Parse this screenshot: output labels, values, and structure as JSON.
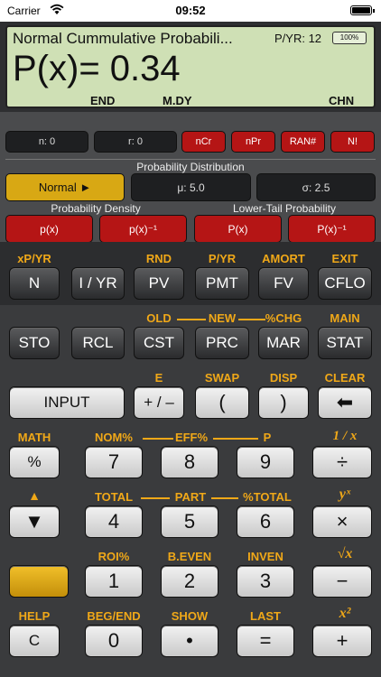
{
  "status_bar": {
    "carrier": "Carrier",
    "time": "09:52"
  },
  "display": {
    "title": "Normal Cummulative Probabili...",
    "pyr": "P/YR: 12",
    "battery": "100%",
    "readout": "P(x)= 0.34",
    "annunciators": [
      "END",
      "M.DY",
      "CHN"
    ]
  },
  "prob_panel": {
    "row1": [
      "n: 0",
      "r: 0",
      "nCr",
      "nPr",
      "RAN#",
      "N!"
    ],
    "distribution_label": "Probability Distribution",
    "distribution_selected": "Normal ►",
    "mu": "μ: 5.0",
    "sigma": "σ: 2.5",
    "density_label": "Probability Density",
    "lowertail_label": "Lower-Tail Probability",
    "density_buttons": [
      "p(x)",
      "p(x)⁻¹"
    ],
    "lowertail_buttons": [
      "P(x)",
      "P(x)⁻¹"
    ]
  },
  "keypad": {
    "row1_labels": [
      "xP/YR",
      "RND",
      "P/YR",
      "AMORT",
      "EXIT"
    ],
    "row1_keys": [
      "N",
      "I / YR",
      "PV",
      "PMT",
      "FV",
      "CFLO"
    ],
    "row2_labels": [
      "OLD",
      "NEW",
      "%CHG",
      "MAIN"
    ],
    "row2_keys": [
      "STO",
      "RCL",
      "CST",
      "PRC",
      "MAR",
      "STAT"
    ],
    "row3_labels": [
      "E",
      "SWAP",
      "DISP",
      "CLEAR"
    ],
    "row3_keys": [
      "INPUT",
      "+ / –",
      "(",
      ")",
      "⬅"
    ],
    "row4_labels": [
      "MATH",
      "NOM%",
      "EFF%",
      "P",
      "1 / x"
    ],
    "row4_keys": [
      "%",
      "7",
      "8",
      "9",
      "÷"
    ],
    "row5_labels": [
      "▲",
      "TOTAL",
      "PART",
      "%TOTAL",
      "yˣ"
    ],
    "row5_keys": [
      "▼",
      "4",
      "5",
      "6",
      "×"
    ],
    "row6_labels": [
      "ROI%",
      "B.EVEN",
      "INVEN",
      "√x"
    ],
    "row6_keys": [
      "",
      "1",
      "2",
      "3",
      "−"
    ],
    "row7_labels": [
      "HELP",
      "BEG/END",
      "SHOW",
      "LAST",
      "x²"
    ],
    "row7_keys": [
      "C",
      "0",
      "•",
      "=",
      "+"
    ]
  }
}
